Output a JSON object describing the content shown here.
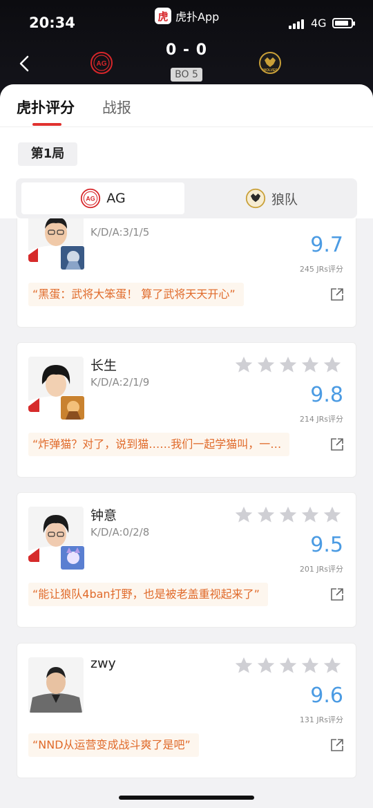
{
  "status_bar": {
    "time": "20:34",
    "network": "4G",
    "battery_level": 0.85
  },
  "app": {
    "logo_glyph": "虎",
    "name": "虎扑App"
  },
  "match": {
    "score": "0 - 0",
    "format": "BO 5",
    "home_logo_text": "AG",
    "away_logo_text": "WOLVES"
  },
  "tabs": [
    {
      "label": "虎扑评分",
      "active": true
    },
    {
      "label": "战报",
      "active": false
    }
  ],
  "game": {
    "label": "第1局"
  },
  "teams": [
    {
      "name": "AG",
      "selected": true,
      "logo_text": "AG"
    },
    {
      "name": "狼队",
      "selected": false,
      "logo_text": "WOLVES"
    }
  ],
  "players": [
    {
      "name": "",
      "kda": "K/D/A:3/1/5",
      "rating": "9.7",
      "votes": "245 JRs评分",
      "comment": "“黑蛋：武将大笨蛋！ 算了武将天天开心”"
    },
    {
      "name": "长生",
      "kda": "K/D/A:2/1/9",
      "rating": "9.8",
      "votes": "214 JRs评分",
      "comment": "“炸弹猫？对了，说到猫……我们一起学猫叫，一…"
    },
    {
      "name": "钟意",
      "kda": "K/D/A:0/2/8",
      "rating": "9.5",
      "votes": "201 JRs评分",
      "comment": "“能让狼队4ban打野，也是被老盖重视起来了”"
    },
    {
      "name": "zwy",
      "kda": "",
      "rating": "9.6",
      "votes": "131 JRs评分",
      "comment": "“NND从运营变成战斗爽了是吧”"
    }
  ],
  "colors": {
    "accent_red": "#e0322f",
    "rating_blue": "#4b9be3",
    "comment_orange": "#e06a2a",
    "ag_red": "#d7262a",
    "wolves_gold": "#c9a038"
  }
}
